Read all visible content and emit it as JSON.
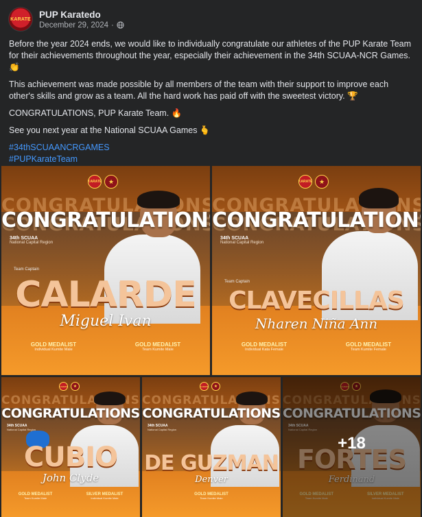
{
  "post": {
    "author": "PUP Karatedo",
    "avatar_text": "KARATE",
    "date": "December 29, 2024",
    "separator": "·",
    "paragraphs": [
      "Before the year 2024 ends, we would like to individually congratulate our athletes of the PUP Karate Team for their achievements throughout the year, especially their achievement in the 34th SCUAA-NCR Games. 👏",
      "This achievement was made possible by all members of the team with their support to improve each other's skills and grow as a team. All the hard work has paid off with the sweetest victory. 🏆",
      "CONGRATULATIONS, PUP Karate Team. 🔥",
      "See you next year at the National SCUAA Games 🫰"
    ],
    "hashtags": [
      "#34thSCUAANCRGAMES",
      "#PUPKarateTeam"
    ]
  },
  "photos": [
    {
      "congrats": "CONGRATULATIONS",
      "ghost": "CONGRATULATIONS",
      "event": "34th SCUAA",
      "event_sub": "National Capital Region",
      "captain": "Team Captain",
      "surname": "CALARDE",
      "firstname": "Miguel Ivan",
      "medals": [
        {
          "title": "GOLD MEDALIST",
          "sub": "Individual Kumite Male"
        },
        {
          "title": "GOLD MEDALIST",
          "sub": "Team Kumite Male"
        }
      ]
    },
    {
      "congrats": "CONGRATULATIONS",
      "ghost": "CONGRATULATIONS",
      "event": "34th SCUAA",
      "event_sub": "National Capital Region",
      "captain": "Team Captain",
      "surname": "CLAVECILLAS",
      "firstname": "Nharen Niña Ann",
      "medals": [
        {
          "title": "GOLD MEDALIST",
          "sub": "Individual Kata Female"
        },
        {
          "title": "GOLD MEDALIST",
          "sub": "Team Kumite Female"
        }
      ]
    },
    {
      "congrats": "CONGRATULATIONS",
      "ghost": "CONGRATULATIONS",
      "event": "34th SCUAA",
      "event_sub": "National Capital Region",
      "surname": "CUBIO",
      "firstname": "John Clyde",
      "medals": [
        {
          "title": "GOLD MEDALIST",
          "sub": "Team Kumite Male"
        },
        {
          "title": "SILVER MEDALIST",
          "sub": "Individual Kumite Male"
        }
      ]
    },
    {
      "congrats": "CONGRATULATIONS",
      "ghost": "CONGRATULATIONS",
      "event": "34th SCUAA",
      "event_sub": "National Capital Region",
      "surname": "DE GUZMAN",
      "firstname": "Denver",
      "medals": [
        {
          "title": "GOLD MEDALIST",
          "sub": "Team Kumite Male"
        }
      ]
    },
    {
      "congrats": "CONGRATULATIONS",
      "ghost": "CONGRATULATIONS",
      "event": "34th SCUAA",
      "event_sub": "National Capital Region",
      "surname": "FORTES",
      "firstname": "Ferdinand",
      "medals": [
        {
          "title": "GOLD MEDALIST",
          "sub": "Team Kumite Male"
        },
        {
          "title": "SILVER MEDALIST",
          "sub": "Individual Kumite Male"
        }
      ],
      "more_count": "+18"
    }
  ],
  "colors": {
    "background": "#242526",
    "text": "#e4e6eb",
    "secondary_text": "#b0b3b8",
    "hashtag": "#4599ff",
    "tile_orange": "#e38321"
  },
  "icons": {
    "privacy": "globe-icon"
  }
}
